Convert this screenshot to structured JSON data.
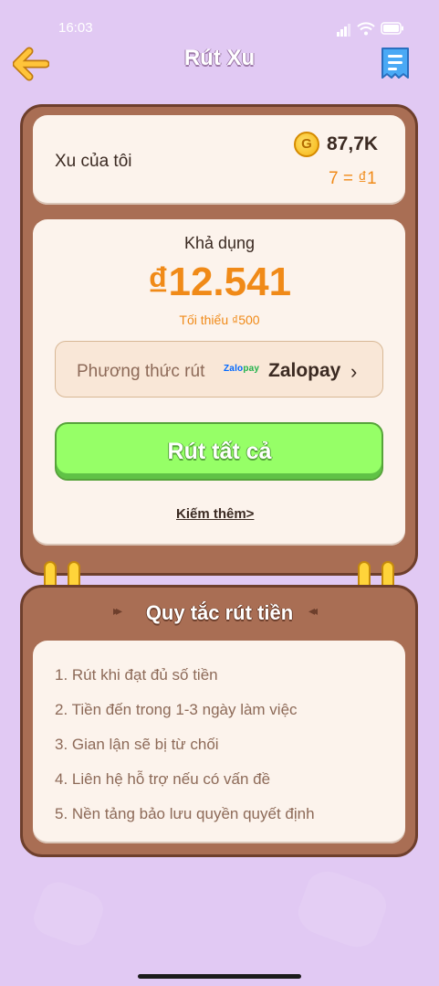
{
  "status_bar": {
    "time": "16:03",
    "battery": "battery-icon",
    "wifi": "wifi-icon",
    "signal": "signal-icon"
  },
  "header": {
    "title": "Rút Xu",
    "back_icon": "arrow-left-icon",
    "record_icon": "receipt-icon"
  },
  "balance": {
    "label": "Xu của tôi",
    "coin_symbol": "G",
    "amount": "87,7K",
    "rate": "7 = ₫1"
  },
  "withdraw": {
    "available_label": "Khả dụng",
    "available_amount": "₫12.541",
    "minimum_note": "Tối thiểu ₫500",
    "method_label": "Phương thức rút",
    "method_logo_a": "Zalo",
    "method_logo_b": "pay",
    "method_name": "Zalopay",
    "chevron": "›",
    "button_label": "Rút tất cả",
    "earn_more": "Kiếm thêm>"
  },
  "rules": {
    "title": "Quy tắc rút tiền",
    "left_arrow": "▸▸",
    "right_arrow": "◂◂",
    "items": [
      "1. Rút khi đạt đủ số tiền",
      "2. Tiền đến trong 1-3 ngày làm việc",
      "3. Gian lận sẽ bị từ chối",
      "4. Liên hệ hỗ trợ nếu có vấn đề",
      "5. Nền tảng bảo lưu quyền quyết định"
    ]
  },
  "colors": {
    "background": "#e1c9f3",
    "accent": "#f08a18",
    "board": "#a96e54",
    "button": "#96ff67"
  }
}
